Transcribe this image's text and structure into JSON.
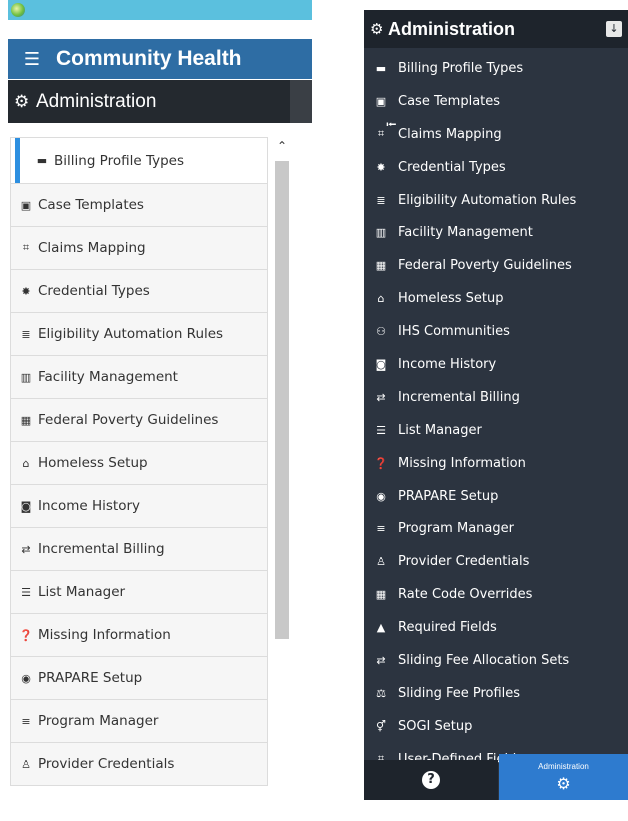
{
  "left_panel": {
    "app_title": "Community Health",
    "section_title": "Administration",
    "items": [
      {
        "label": "Billing Profile Types",
        "icon": "briefcase-icon",
        "glyph": "▬",
        "active": true
      },
      {
        "label": "Case Templates",
        "icon": "suitcase-icon",
        "glyph": "▣"
      },
      {
        "label": "Claims Mapping",
        "icon": "map-grid-icon",
        "glyph": "⌗"
      },
      {
        "label": "Credential Types",
        "icon": "certificate-icon",
        "glyph": "✸"
      },
      {
        "label": "Eligibility Automation Rules",
        "icon": "sliders-icon",
        "glyph": "≣"
      },
      {
        "label": "Facility Management",
        "icon": "building-icon",
        "glyph": "▥"
      },
      {
        "label": "Federal Poverty Guidelines",
        "icon": "table-icon",
        "glyph": "▦"
      },
      {
        "label": "Homeless Setup",
        "icon": "home-icon",
        "glyph": "⌂"
      },
      {
        "label": "Income History",
        "icon": "money-icon",
        "glyph": "◙"
      },
      {
        "label": "Incremental Billing",
        "icon": "exchange-icon",
        "glyph": "⇄"
      },
      {
        "label": "List Manager",
        "icon": "list-icon",
        "glyph": "☰"
      },
      {
        "label": "Missing Information",
        "icon": "question-circle-icon",
        "glyph": "❓"
      },
      {
        "label": "PRAPARE Setup",
        "icon": "user-circle-icon",
        "glyph": "◉"
      },
      {
        "label": "Program Manager",
        "icon": "tasks-icon",
        "glyph": "≡"
      },
      {
        "label": "Provider Credentials",
        "icon": "user-md-icon",
        "glyph": "♙"
      }
    ]
  },
  "right_panel": {
    "title": "Administration",
    "items": [
      {
        "label": "Billing Profile Types",
        "icon": "briefcase-icon",
        "glyph": "▬"
      },
      {
        "label": "Case Templates",
        "icon": "suitcase-icon",
        "glyph": "▣"
      },
      {
        "label": "Claims Mapping",
        "icon": "map-grid-icon",
        "glyph": "⌗"
      },
      {
        "label": "Credential Types",
        "icon": "certificate-icon",
        "glyph": "✸"
      },
      {
        "label": "Eligibility Automation Rules",
        "icon": "sliders-icon",
        "glyph": "≣"
      },
      {
        "label": "Facility Management",
        "icon": "building-icon",
        "glyph": "▥"
      },
      {
        "label": "Federal Poverty Guidelines",
        "icon": "table-icon",
        "glyph": "▦"
      },
      {
        "label": "Homeless Setup",
        "icon": "home-icon",
        "glyph": "⌂"
      },
      {
        "label": "IHS Communities",
        "icon": "users-icon",
        "glyph": "⚇"
      },
      {
        "label": "Income History",
        "icon": "money-icon",
        "glyph": "◙"
      },
      {
        "label": "Incremental Billing",
        "icon": "exchange-icon",
        "glyph": "⇄"
      },
      {
        "label": "List Manager",
        "icon": "list-icon",
        "glyph": "☰"
      },
      {
        "label": "Missing Information",
        "icon": "question-circle-icon",
        "glyph": "❓"
      },
      {
        "label": "PRAPARE Setup",
        "icon": "user-circle-icon",
        "glyph": "◉"
      },
      {
        "label": "Program Manager",
        "icon": "tasks-icon",
        "glyph": "≡"
      },
      {
        "label": "Provider Credentials",
        "icon": "user-md-icon",
        "glyph": "♙"
      },
      {
        "label": "Rate Code Overrides",
        "icon": "calculator-icon",
        "glyph": "▦"
      },
      {
        "label": "Required Fields",
        "icon": "warning-icon",
        "glyph": "▲"
      },
      {
        "label": "Sliding Fee Allocation Sets",
        "icon": "exchange-icon",
        "glyph": "⇄"
      },
      {
        "label": "Sliding Fee Profiles",
        "icon": "balance-scale-icon",
        "glyph": "⚖"
      },
      {
        "label": "SOGI Setup",
        "icon": "genderless-icon",
        "glyph": "⚥"
      },
      {
        "label": "User-Defined Fields",
        "icon": "map-grid-icon",
        "glyph": "⌗"
      }
    ],
    "footer": {
      "help_glyph": "?",
      "admin_label": "Administration"
    }
  },
  "colors": {
    "left_header": "#2e6da4",
    "left_topbar": "#5bc0de",
    "active_accent": "#2d8fe0",
    "right_bg": "#2c3440",
    "right_header": "#1e242c",
    "admin_button": "#2e7bcf"
  }
}
